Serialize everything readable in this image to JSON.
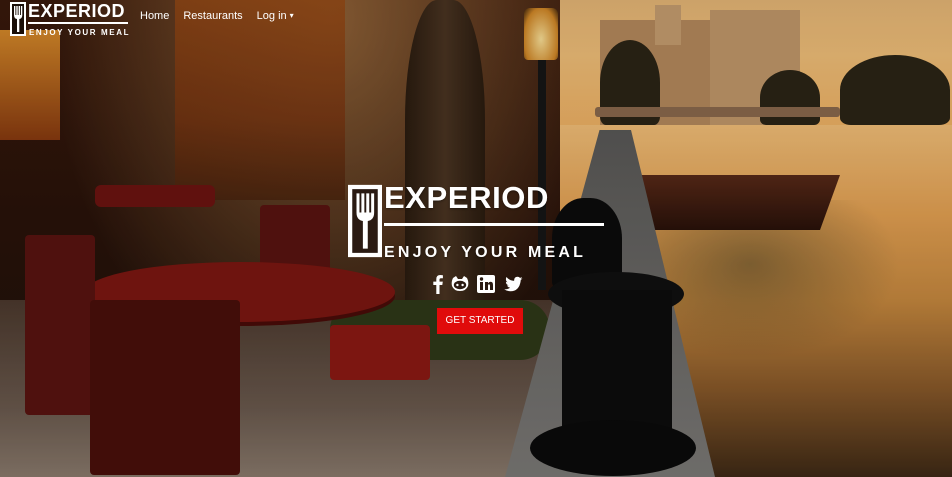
{
  "nav": {
    "brand": {
      "name": "EXPERIOD",
      "tagline": "ENJOY YOUR MEAL",
      "icon": "fork-icon"
    },
    "links": [
      {
        "label": "Home"
      },
      {
        "label": "Restaurants"
      },
      {
        "label": "Log in",
        "icon": "caret-down-icon"
      }
    ]
  },
  "hero": {
    "name": "EXPERIOD",
    "tagline": "ENJOY YOUR MEAL",
    "icon": "fork-icon",
    "socials": [
      "facebook-icon",
      "github-icon",
      "linkedin-icon",
      "twitter-icon"
    ],
    "cta_label": "GET STARTED"
  },
  "colors": {
    "cta": "#e00b0b",
    "text": "#ffffff"
  }
}
